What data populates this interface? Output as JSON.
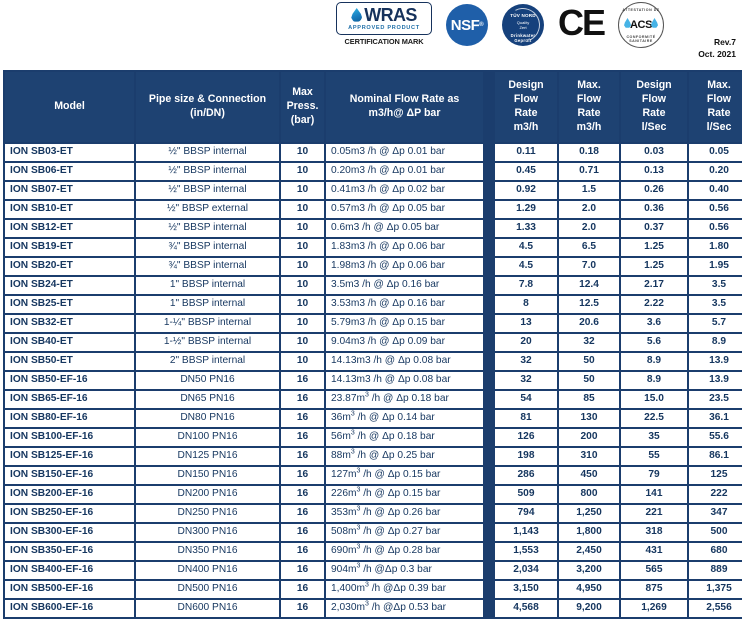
{
  "certifications": [
    {
      "name": "wras-logo",
      "word": "WRAS",
      "sub": "APPROVED  PRODUCT",
      "caption": "CERTIFICATION MARK"
    },
    {
      "name": "nsf-logo",
      "word": "NSF",
      "mark": "®"
    },
    {
      "name": "tuv-logo",
      "top": "TÜV NORD",
      "mid": "Quality\nZert",
      "ring": "Drinkwater Geprüft"
    },
    {
      "name": "ce-logo",
      "word": "CE"
    },
    {
      "name": "acs-logo",
      "word": "ACS",
      "arc_top": "ATTESTATION DE",
      "arc_bottom": "CONFORMITÉ SANITAIRE"
    }
  ],
  "revision": {
    "rev": "Rev.7",
    "date": "Oct. 2021"
  },
  "table": {
    "headers": {
      "model": "Model",
      "pipe_size": "Pipe size & Connection\n(in/DN)",
      "pipe_size_line1": "Pipe size & Connection",
      "pipe_size_line2": "(in/DN)",
      "max_press_line1": "Max",
      "max_press_line2": "Press.",
      "max_press_line3": "(bar)",
      "nominal_line1": "Nominal Flow Rate as",
      "nominal_line2": "m3/h@ ΔP bar",
      "design_m3h": [
        "Design",
        "Flow",
        "Rate",
        "m3/h"
      ],
      "max_m3h": [
        "Max.",
        "Flow",
        "Rate",
        "m3/h"
      ],
      "design_lsec": [
        "Design",
        "Flow",
        "Rate",
        "l/Sec"
      ],
      "max_lsec": [
        "Max.",
        "Flow",
        "Rate",
        "l/Sec"
      ]
    },
    "rows": [
      {
        "model": "ION SB03-ET",
        "pipe": "½\" BBSP internal",
        "press": "10",
        "nominal": "0.05m3 /h @ Δp 0.01 bar",
        "nominal_sup": "",
        "design_m3h": "0.11",
        "max_m3h": "0.18",
        "design_lsec": "0.03",
        "max_lsec": "0.05"
      },
      {
        "model": "ION SB06-ET",
        "pipe": "½\"  BBSP internal",
        "press": "10",
        "nominal": "0.20m3 /h @ Δp 0.01 bar",
        "nominal_sup": "",
        "design_m3h": "0.45",
        "max_m3h": "0.71",
        "design_lsec": "0.13",
        "max_lsec": "0.20"
      },
      {
        "model": "ION SB07-ET",
        "pipe": "½\"  BBSP internal",
        "press": "10",
        "nominal": "0.41m3 /h @ Δp 0.02 bar",
        "nominal_sup": "",
        "design_m3h": "0.92",
        "max_m3h": "1.5",
        "design_lsec": "0.26",
        "max_lsec": "0.40"
      },
      {
        "model": "ION SB10-ET",
        "pipe": "½\"  BBSP external",
        "press": "10",
        "nominal": "0.57m3 /h @ Δp 0.05 bar",
        "nominal_sup": "",
        "design_m3h": "1.29",
        "max_m3h": "2.0",
        "design_lsec": "0.36",
        "max_lsec": "0.56"
      },
      {
        "model": "ION SB12-ET",
        "pipe": "½\"  BBSP internal",
        "press": "10",
        "nominal": "0.6m3 /h @ Δp 0.05 bar",
        "nominal_sup": "",
        "design_m3h": "1.33",
        "max_m3h": "2.0",
        "design_lsec": "0.37",
        "max_lsec": "0.56"
      },
      {
        "model": "ION SB19-ET",
        "pipe": "¾\"  BBSP internal",
        "press": "10",
        "nominal": "1.83m3 /h @ Δp 0.06 bar",
        "nominal_sup": "",
        "design_m3h": "4.5",
        "max_m3h": "6.5",
        "design_lsec": "1.25",
        "max_lsec": "1.80"
      },
      {
        "model": "ION SB20-ET",
        "pipe": "¾\"  BBSP internal",
        "press": "10",
        "nominal": "1.98m3 /h @ Δp 0.06 bar",
        "nominal_sup": "",
        "design_m3h": "4.5",
        "max_m3h": "7.0",
        "design_lsec": "1.25",
        "max_lsec": "1.95"
      },
      {
        "model": "ION SB24-ET",
        "pipe": "1\"  BBSP internal",
        "press": "10",
        "nominal": "3.5m3 /h @ Δp 0.16 bar",
        "nominal_sup": "",
        "design_m3h": "7.8",
        "max_m3h": "12.4",
        "design_lsec": "2.17",
        "max_lsec": "3.5"
      },
      {
        "model": "ION SB25-ET",
        "pipe": "1\"  BBSP internal",
        "press": "10",
        "nominal": "3.53m3 /h @ Δp 0.16 bar",
        "nominal_sup": "",
        "design_m3h": "8",
        "max_m3h": "12.5",
        "design_lsec": "2.22",
        "max_lsec": "3.5"
      },
      {
        "model": "ION SB32-ET",
        "pipe": "1-¼\"  BBSP internal",
        "press": "10",
        "nominal": "5.79m3 /h @ Δp 0.15 bar",
        "nominal_sup": "",
        "design_m3h": "13",
        "max_m3h": "20.6",
        "design_lsec": "3.6",
        "max_lsec": "5.7"
      },
      {
        "model": "ION SB40-ET",
        "pipe": "1-½\"  BBSP internal",
        "press": "10",
        "nominal": "9.04m3 /h @ Δp 0.09 bar",
        "nominal_sup": "",
        "design_m3h": "20",
        "max_m3h": "32",
        "design_lsec": "5.6",
        "max_lsec": "8.9"
      },
      {
        "model": "ION SB50-ET",
        "pipe": "2\"  BBSP internal",
        "press": "10",
        "nominal": "14.13m3 /h @ Δp 0.08 bar",
        "nominal_sup": "",
        "design_m3h": "32",
        "max_m3h": "50",
        "design_lsec": "8.9",
        "max_lsec": "13.9"
      },
      {
        "model": "ION SB50-EF-16",
        "pipe": "DN50 PN16",
        "press": "16",
        "nominal": "14.13m3 /h @ Δp 0.08 bar",
        "nominal_sup": "",
        "design_m3h": "32",
        "max_m3h": "50",
        "design_lsec": "8.9",
        "max_lsec": "13.9"
      },
      {
        "model": "ION SB65-EF-16",
        "pipe": "DN65 PN16",
        "press": "16",
        "nominal": "23.87m³ /h @ Δp 0.18 bar",
        "nominal_sup": "3",
        "design_m3h": "54",
        "max_m3h": "85",
        "design_lsec": "15.0",
        "max_lsec": "23.5"
      },
      {
        "model": "ION SB80-EF-16",
        "pipe": "DN80 PN16",
        "press": "16",
        "nominal": "36m³ /h @ Δp 0.14 bar",
        "nominal_sup": "3",
        "design_m3h": "81",
        "max_m3h": "130",
        "design_lsec": "22.5",
        "max_lsec": "36.1"
      },
      {
        "model": "ION SB100-EF-16",
        "pipe": "DN100 PN16",
        "press": "16",
        "nominal": "56m³ /h @ Δp 0.18 bar",
        "nominal_sup": "3",
        "design_m3h": "126",
        "max_m3h": "200",
        "design_lsec": "35",
        "max_lsec": "55.6"
      },
      {
        "model": "ION SB125-EF-16",
        "pipe": "DN125 PN16",
        "press": "16",
        "nominal": "88m³ /h @ Δp 0.25 bar",
        "nominal_sup": "3",
        "design_m3h": "198",
        "max_m3h": "310",
        "design_lsec": "55",
        "max_lsec": "86.1"
      },
      {
        "model": "ION SB150-EF-16",
        "pipe": "DN150 PN16",
        "press": "16",
        "nominal": "127m³ /h @ Δp 0.15 bar",
        "nominal_sup": "3",
        "design_m3h": "286",
        "max_m3h": "450",
        "design_lsec": "79",
        "max_lsec": "125"
      },
      {
        "model": "ION SB200-EF-16",
        "pipe": "DN200 PN16",
        "press": "16",
        "nominal": "226m³ /h @ Δp 0.15 bar",
        "nominal_sup": "3",
        "design_m3h": "509",
        "max_m3h": "800",
        "design_lsec": "141",
        "max_lsec": "222"
      },
      {
        "model": "ION SB250-EF-16",
        "pipe": "DN250 PN16",
        "press": "16",
        "nominal": "353m³ /h @ Δp 0.26 bar",
        "nominal_sup": "3",
        "design_m3h": "794",
        "max_m3h": "1,250",
        "design_lsec": "221",
        "max_lsec": "347"
      },
      {
        "model": "ION SB300-EF-16",
        "pipe": "DN300 PN16",
        "press": "16",
        "nominal": "508m³ /h @ Δp 0.27 bar",
        "nominal_sup": "3",
        "design_m3h": "1,143",
        "max_m3h": "1,800",
        "design_lsec": "318",
        "max_lsec": "500"
      },
      {
        "model": "ION SB350-EF-16",
        "pipe": "DN350 PN16",
        "press": "16",
        "nominal": "690m³ /h @ Δp 0.28 bar",
        "nominal_sup": "3",
        "design_m3h": "1,553",
        "max_m3h": "2,450",
        "design_lsec": "431",
        "max_lsec": "680"
      },
      {
        "model": "ION SB400-EF-16",
        "pipe": "DN400 PN16",
        "press": "16",
        "nominal": "904m³ /h @Δp 0.3 bar",
        "nominal_sup": "3",
        "design_m3h": "2,034",
        "max_m3h": "3,200",
        "design_lsec": "565",
        "max_lsec": "889"
      },
      {
        "model": "ION SB500-EF-16",
        "pipe": "DN500 PN16",
        "press": "16",
        "nominal": "1,400m³ /h @Δp 0.39 bar",
        "nominal_sup": "3",
        "design_m3h": "3,150",
        "max_m3h": "4,950",
        "design_lsec": "875",
        "max_lsec": "1,375"
      },
      {
        "model": "ION SB600-EF-16",
        "pipe": "DN600 PN16",
        "press": "16",
        "nominal": "2,030m³ /h @Δp 0.53 bar",
        "nominal_sup": "3",
        "design_m3h": "4,568",
        "max_m3h": "9,200",
        "design_lsec": "1,269",
        "max_lsec": "2,556"
      }
    ]
  },
  "colors": {
    "header_bg": "#1e4272",
    "grid": "#1b3d6d",
    "text": "#15365f",
    "brand_blue": "#1f5fa9"
  }
}
